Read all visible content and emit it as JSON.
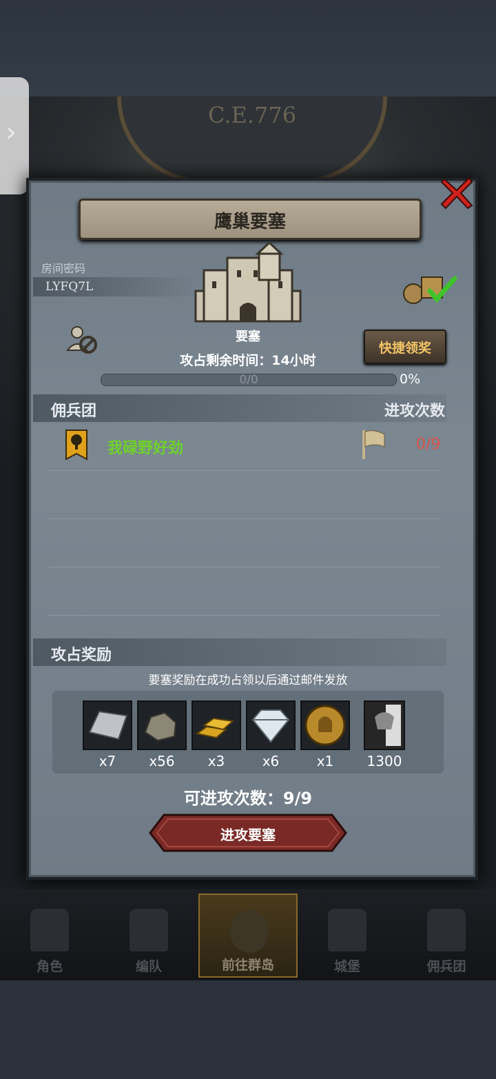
{
  "era": "C.E.776",
  "dialog": {
    "title": "鹰巢要塞",
    "room_password_label": "房间密码",
    "room_password": "LYFQ7L",
    "fortress_label": "要塞",
    "quick_claim_label": "快捷领奖",
    "time_remaining": "攻占剩余时间：14小时",
    "progress_text": "0/0",
    "progress_percent": "0%",
    "progress_fraction": 0
  },
  "mercenary_section": {
    "title": "佣兵团",
    "right_header": "进攻次数",
    "rows": [
      {
        "name": "我碌野好劲",
        "count": "0/9"
      }
    ]
  },
  "reward_section": {
    "title": "攻占奖励",
    "note": "要塞奖励在成功占领以后通过邮件发放",
    "items": [
      {
        "icon": "silver-ingot-icon",
        "qty": "x7"
      },
      {
        "icon": "ore-icon",
        "qty": "x56"
      },
      {
        "icon": "gold-bar-icon",
        "qty": "x3"
      },
      {
        "icon": "diamond-icon",
        "qty": "x6"
      },
      {
        "icon": "knight-coin-icon",
        "qty": "x1"
      },
      {
        "icon": "honor-banner-icon",
        "qty": "1300"
      }
    ]
  },
  "attempts": "可进攻次数：9/9",
  "attack_button": "进攻要塞",
  "nav": [
    {
      "label": "角色"
    },
    {
      "label": "编队"
    },
    {
      "label": "前往群岛",
      "active": true
    },
    {
      "label": "城堡"
    },
    {
      "label": "佣兵团"
    }
  ]
}
